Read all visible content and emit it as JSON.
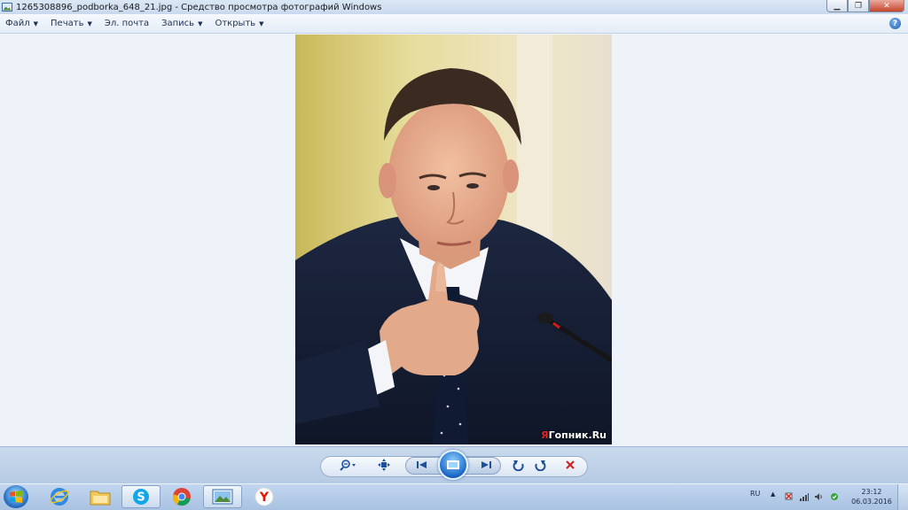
{
  "window": {
    "title": "1265308896_podborka_648_21.jpg - Средство просмотра фотографий Windows"
  },
  "menu": {
    "items": [
      {
        "label": "Файл",
        "has_dropdown": true
      },
      {
        "label": "Печать",
        "has_dropdown": true
      },
      {
        "label": "Эл. почта",
        "has_dropdown": false
      },
      {
        "label": "Запись",
        "has_dropdown": true
      },
      {
        "label": "Открыть",
        "has_dropdown": true
      }
    ],
    "help_label": "?"
  },
  "photo": {
    "watermark_prefix": "Я",
    "watermark_text": "Гопник.Ru"
  },
  "controls": {
    "zoom_icon": "zoom-magnifier-icon",
    "fit_icon": "actual-size-icon",
    "prev_icon": "previous-icon",
    "slideshow_icon": "slideshow-icon",
    "next_icon": "next-icon",
    "rotate_ccw_icon": "rotate-counterclockwise-icon",
    "rotate_cw_icon": "rotate-clockwise-icon",
    "delete_icon": "delete-icon"
  },
  "taskbar": {
    "apps": [
      "internet-explorer-icon",
      "file-explorer-icon",
      "skype-icon",
      "chrome-icon",
      "photo-viewer-icon",
      "yandex-browser-icon"
    ],
    "language": "RU",
    "time": "23:12",
    "date": "06.03.2016"
  },
  "colors": {
    "close_button": "#c7442b",
    "accent_blue": "#1f5fb8",
    "delete_red": "#d21e1e"
  }
}
